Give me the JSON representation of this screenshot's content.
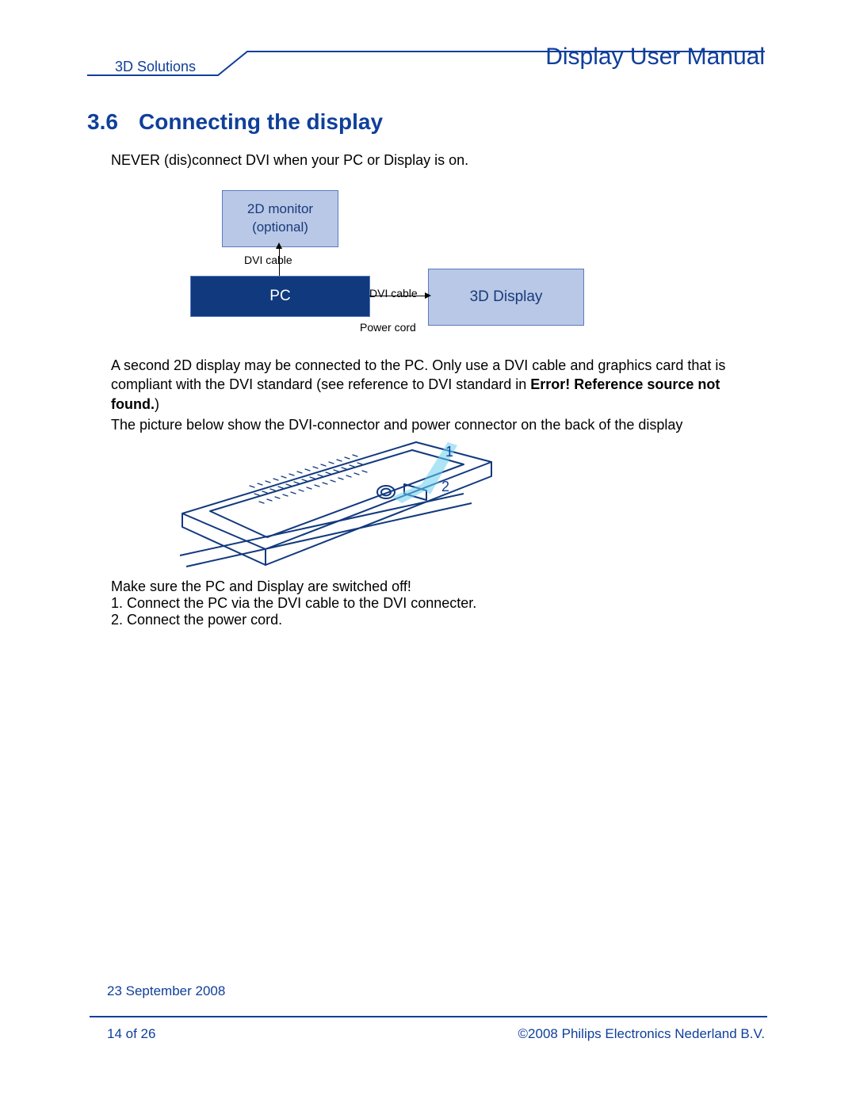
{
  "header": {
    "doc_title": "Display User Manual",
    "tab": "3D Solutions"
  },
  "section": {
    "number": "3.6",
    "title": "Connecting the display"
  },
  "paragraphs": {
    "warning": "NEVER (dis)connect DVI when your PC or Display is on.",
    "second_display_a": "A second 2D display may be connected to the PC. Only use a DVI cable and graphics card that is compliant with the DVI standard (see reference to DVI standard in ",
    "second_display_bold": "Error! Reference source not found.",
    "second_display_b": ")",
    "picture_intro": "The picture below show the DVI-connector and power connector on the back of the display",
    "steps_intro": "Make sure the PC and Display are switched off!",
    "step1": "1. Connect the PC via the DVI cable to the DVI connecter.",
    "step2": "2. Connect the power cord."
  },
  "diagram": {
    "box_2d_line1": "2D monitor",
    "box_2d_line2": "(optional)",
    "box_pc": "PC",
    "box_3d": "3D Display",
    "label_dvi_up": "DVI cable",
    "label_dvi_right": "DVI cable",
    "label_power": "Power cord"
  },
  "callouts": {
    "c1": "1",
    "c2": "2"
  },
  "footer": {
    "date": "23 September 2008",
    "page": "14 of 26",
    "copyright": "©2008 Philips Electronics Nederland B.V."
  }
}
